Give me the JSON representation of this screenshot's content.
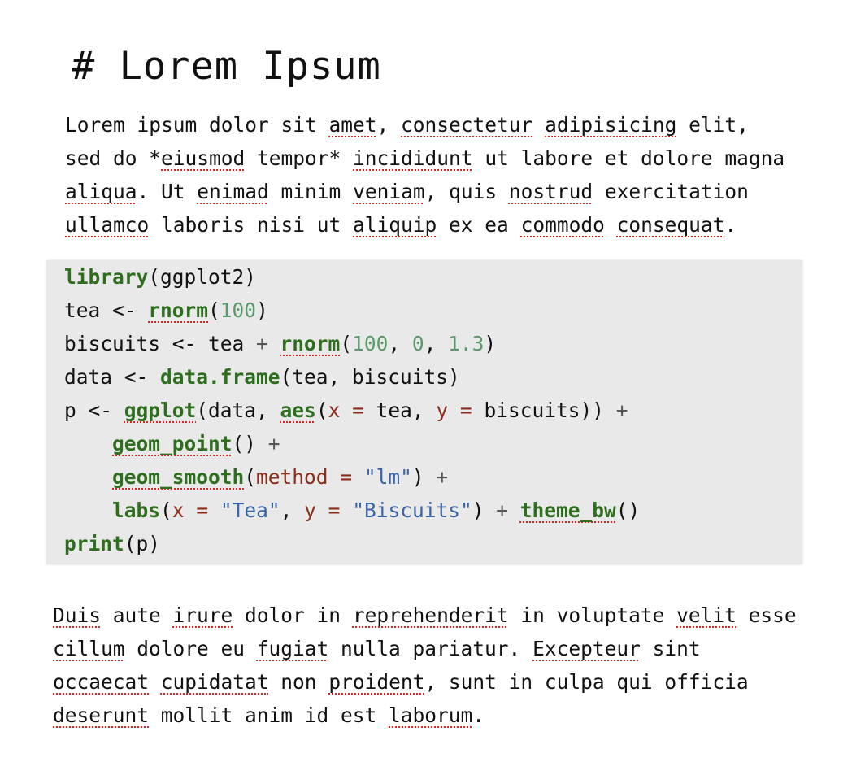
{
  "heading": "# Lorem Ipsum",
  "para1": {
    "line1": [
      "Lorem ipsum dolor sit ",
      "amet",
      ", ",
      "consectetur",
      " ",
      "adipisicing",
      " elit,"
    ],
    "line2": [
      "sed do *",
      "eiusmod",
      " tempor* ",
      "incididunt",
      " ut labore et dolore magna"
    ],
    "line3": [
      "aliqua",
      ". Ut ",
      "enimad",
      " minim ",
      "veniam",
      ", quis ",
      "nostrud",
      " exercitation"
    ],
    "line4": [
      "ullamco",
      " laboris nisi ut ",
      "aliquip",
      " ex ea ",
      "commodo",
      " ",
      "consequat",
      "."
    ]
  },
  "code": {
    "l1": [
      "library",
      "(ggplot2)"
    ],
    "l2": [
      "tea <- ",
      "rnorm",
      "(",
      "100",
      ")"
    ],
    "l3": [
      "biscuits <- tea ",
      "+",
      " ",
      "rnorm",
      "(",
      "100",
      ", ",
      "0",
      ", ",
      "1.3",
      ")"
    ],
    "l4": [
      "data <- ",
      "data.frame",
      "(tea, biscuits)"
    ],
    "l5": [
      "p <- ",
      "ggplot",
      "(data, ",
      "aes",
      "(",
      "x",
      " ",
      "=",
      " tea, ",
      "y",
      " ",
      "=",
      " biscuits)) ",
      "+"
    ],
    "l6": [
      "    ",
      "geom_point",
      "() ",
      "+"
    ],
    "l7": [
      "    ",
      "geom_smooth",
      "(",
      "method",
      " ",
      "=",
      " ",
      "\"lm\"",
      ") ",
      "+"
    ],
    "l8": [
      "    ",
      "labs",
      "(",
      "x",
      " ",
      "=",
      " ",
      "\"Tea\"",
      ", ",
      "y",
      " ",
      "=",
      " ",
      "\"Biscuits\"",
      ") ",
      "+",
      " ",
      "theme_bw",
      "()"
    ],
    "l9": [
      "print",
      "(p)"
    ]
  },
  "para2": {
    "line1": [
      "Duis",
      " aute ",
      "irure",
      " dolor in ",
      "reprehenderit",
      " in voluptate ",
      "velit",
      " esse"
    ],
    "line2": [
      "cillum",
      " dolore eu ",
      "fugiat",
      " nulla pariatur. ",
      "Excepteur",
      " sint"
    ],
    "line3": [
      "occaecat",
      " ",
      "cupidatat",
      " non ",
      "proident",
      ", sunt in culpa qui officia"
    ],
    "line4": [
      "deserunt",
      " mollit anim id est ",
      "laborum",
      "."
    ]
  }
}
